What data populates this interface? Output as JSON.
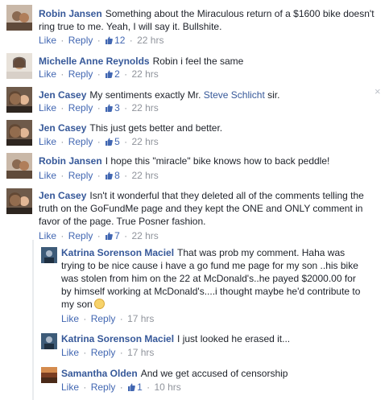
{
  "actions": {
    "like": "Like",
    "reply": "Reply",
    "dot": "·"
  },
  "colors": {
    "link": "#365899",
    "meta": "#90949c",
    "accent": "#4267b2"
  },
  "comments": [
    {
      "author": "Robin Jansen",
      "text": "Something about the Miraculous return of a $1600 bike doesn't ring true to me. Yeah, I will say it. Bullshite.",
      "likes": "12",
      "time": "22 hrs"
    },
    {
      "author": "Michelle Anne Reynolds",
      "text": "Robin i feel the same",
      "likes": "2",
      "time": "22 hrs"
    },
    {
      "author": "Jen Casey",
      "text_before": "My sentiments exactly Mr. ",
      "mention": "Steve Schlicht",
      "text_after": " sir.",
      "likes": "3",
      "time": "22 hrs"
    },
    {
      "author": "Jen Casey",
      "text": "This just gets better and better.",
      "likes": "5",
      "time": "22 hrs"
    },
    {
      "author": "Robin Jansen",
      "text": "I hope this \"miracle\" bike knows how to back peddle!",
      "likes": "8",
      "time": "22 hrs"
    },
    {
      "author": "Jen Casey",
      "text": "Isn't it wonderful that they deleted all of the comments telling the truth on the GoFundMe page and they kept the ONE and ONLY comment in favor of the page. True Posner fashion.",
      "likes": "7",
      "time": "22 hrs"
    }
  ],
  "replies": [
    {
      "author": "Katrina Sorenson Maciel",
      "text": "That was prob my comment. Haha was trying to be nice cause i have a go fund me page for my son ..his bike was stolen from him on the 22 at McDonald's..he payed $2000.00 for by himself working at McDonald's....i thought maybe he'd contribute to my son",
      "time": "17 hrs"
    },
    {
      "author": "Katrina Sorenson Maciel",
      "text": "I just looked he erased it...",
      "time": "17 hrs"
    },
    {
      "author": "Samantha Olden",
      "text": "And we get accused of censorship",
      "likes": "1",
      "time": "10 hrs"
    }
  ],
  "close_icon": "×"
}
